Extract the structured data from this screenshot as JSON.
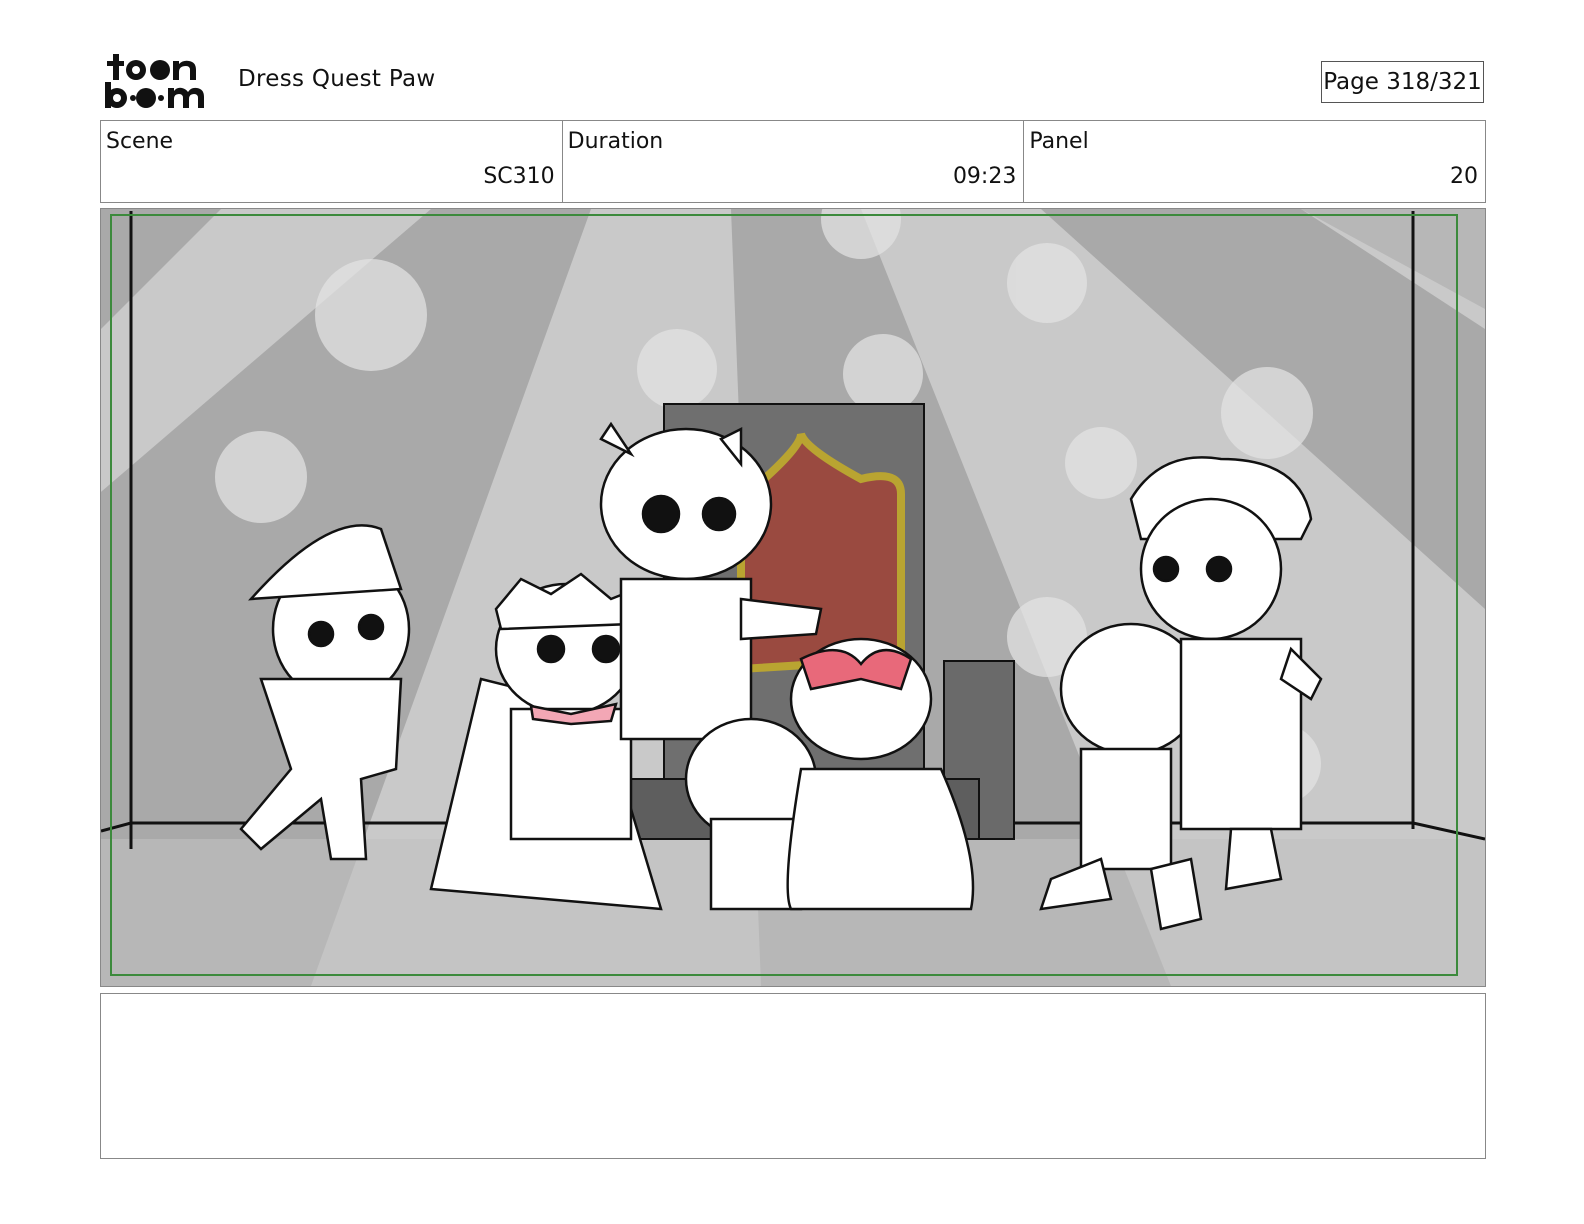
{
  "header": {
    "logo_text": "toon boom",
    "project_title": "Dress Quest Paw",
    "page_label": "Page 318/321"
  },
  "info": {
    "scene_label": "Scene",
    "scene_value": "SC310",
    "duration_label": "Duration",
    "duration_value": "09:23",
    "panel_label": "Panel",
    "panel_value": "20"
  },
  "panel_image": {
    "description_icon": "storyboard-sketch-image"
  },
  "colors": {
    "safe_frame": "#3c8a3c",
    "ribbon": "#e8697a",
    "throne_gold": "#b9a431",
    "throne_red": "#9a4a40"
  },
  "notes": {
    "text": ""
  }
}
